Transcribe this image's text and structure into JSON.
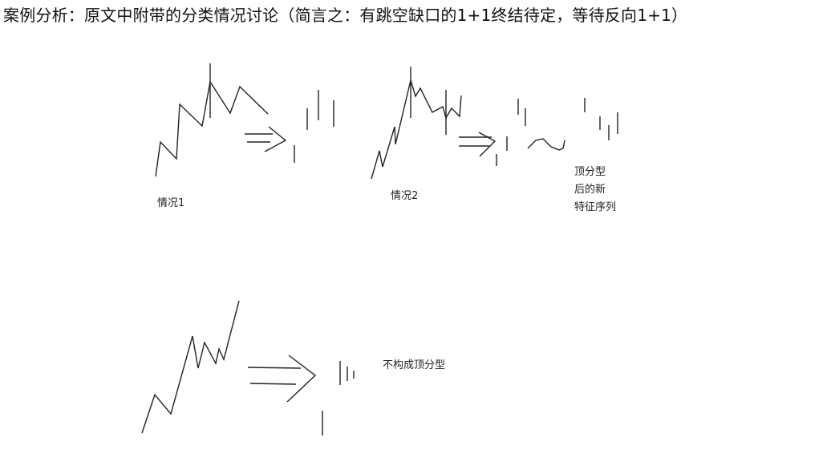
{
  "title": "案例分析：原文中附带的分类情况讨论（简言之：有跳空缺口的1+1终结待定，等待反向1+1）",
  "diagrams": {
    "case1": {
      "label": "情况1"
    },
    "case2": {
      "label": "情况2",
      "note": [
        "顶分型",
        "后的新",
        "特征序列"
      ]
    },
    "case3": {
      "note": "不构成顶分型"
    }
  },
  "colors": {
    "line": "#222222",
    "background": "#ffffff"
  }
}
